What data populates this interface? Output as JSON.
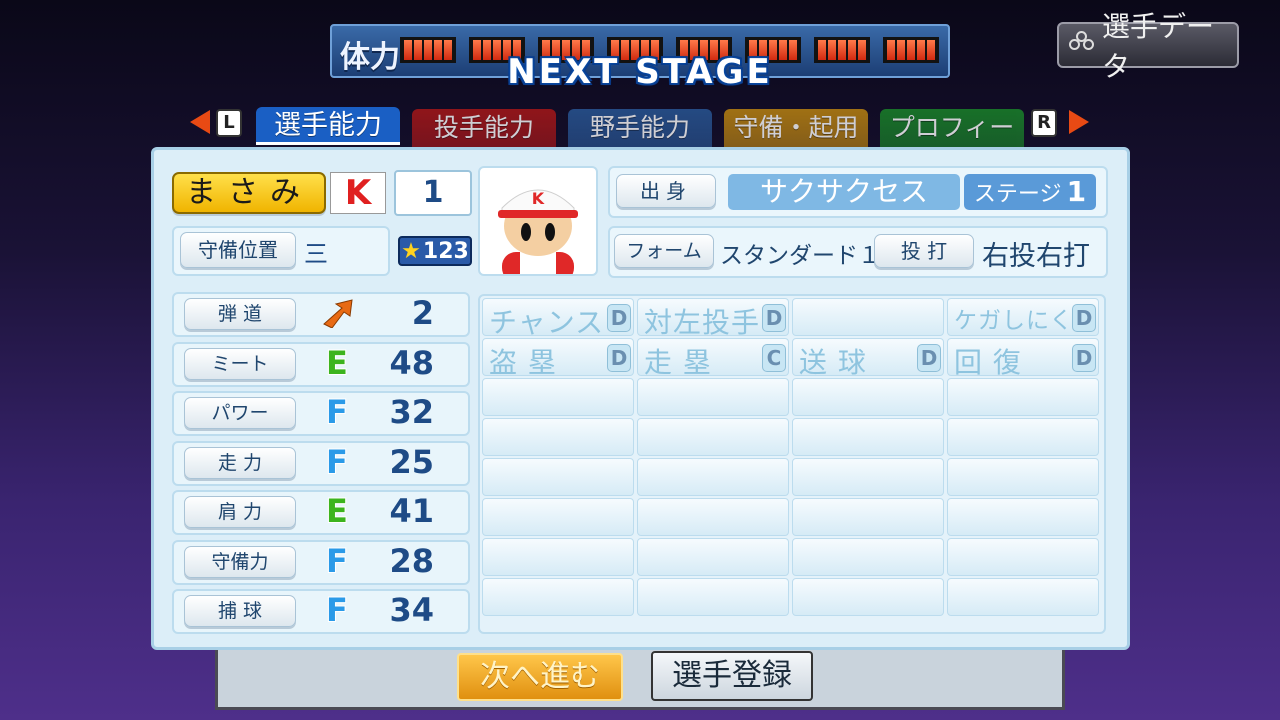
{
  "header": {
    "stamina_label": "体力",
    "stamina_segments": 8,
    "stage_title": "NEXT STAGE",
    "player_data_button": "選手データ"
  },
  "tabs": {
    "left_key": "L",
    "right_key": "R",
    "items": [
      {
        "label": "選手能力",
        "color": "#1a5fc4",
        "active": true
      },
      {
        "label": "投手能力",
        "color": "#b01818",
        "active": false
      },
      {
        "label": "野手能力",
        "color": "#2a5a9a",
        "active": false
      },
      {
        "label": "守備・起用",
        "color": "#c48a10",
        "active": false
      },
      {
        "label": "プロフィール",
        "color": "#1a8a2a",
        "active": false
      }
    ]
  },
  "player": {
    "name": "まさみ",
    "team_letter": "K",
    "number": "1",
    "position_label": "守備位置",
    "position_value": "三",
    "star_value": "123"
  },
  "info": {
    "origin_label": "出身",
    "origin_value": "サクサクセス",
    "stage_label": "ステージ",
    "stage_value": "1",
    "form_label": "フォーム",
    "form_value": "スタンダード１",
    "bat_throw_label": "投 打",
    "bat_throw_value": "右投右打"
  },
  "abilities": [
    {
      "label": "弾 道",
      "grade": "",
      "value": "2",
      "grade_color": "#e86a14"
    },
    {
      "label": "ミート",
      "grade": "E",
      "value": "48",
      "grade_color": "#3cb41e"
    },
    {
      "label": "パワー",
      "grade": "F",
      "value": "32",
      "grade_color": "#2a9ae8"
    },
    {
      "label": "走 力",
      "grade": "F",
      "value": "25",
      "grade_color": "#2a9ae8"
    },
    {
      "label": "肩 力",
      "grade": "E",
      "value": "41",
      "grade_color": "#3cb41e"
    },
    {
      "label": "守備力",
      "grade": "F",
      "value": "28",
      "grade_color": "#2a9ae8"
    },
    {
      "label": "捕 球",
      "grade": "F",
      "value": "34",
      "grade_color": "#2a9ae8"
    }
  ],
  "skills": [
    {
      "name": "チャンス",
      "grade": "D"
    },
    {
      "name": "対左投手",
      "grade": "D"
    },
    {
      "name": "",
      "grade": ""
    },
    {
      "name": "ケガしにくさ",
      "grade": "D"
    },
    {
      "name": "盗 塁",
      "grade": "D"
    },
    {
      "name": "走 塁",
      "grade": "C"
    },
    {
      "name": "送 球",
      "grade": "D"
    },
    {
      "name": "回 復",
      "grade": "D"
    }
  ],
  "buttons": {
    "next": "次へ進む",
    "register": "選手登録"
  }
}
